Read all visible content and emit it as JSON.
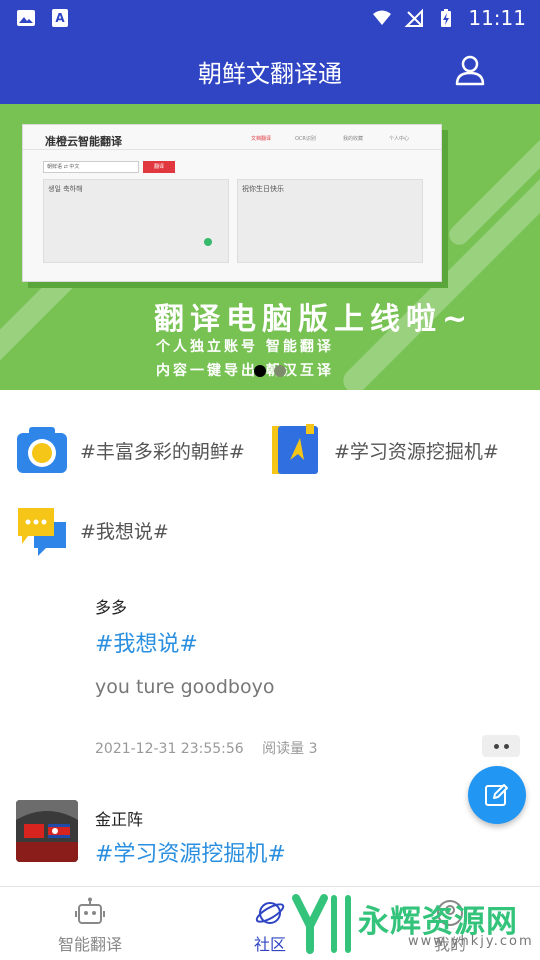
{
  "status_bar": {
    "time": "11:11"
  },
  "header": {
    "title": "朝鲜文翻译通"
  },
  "banner": {
    "screen_title": "准橙云智能翻译",
    "screen_nav": [
      "文档翻译",
      "OCR识别",
      "我的收藏",
      "个人中心"
    ],
    "screen_source_lang": "朝鲜语  ⇄  中文",
    "screen_button": "翻译",
    "screen_input": "생일 축하해",
    "screen_output": "祝你生日快乐",
    "headline": "翻译电脑版上线啦~",
    "line1": "个人独立账号  智能翻译",
    "line2": "内容一键导出  朝汉互译",
    "active_slide": 1,
    "slide_count": 2
  },
  "topics": [
    {
      "label": "#丰富多彩的朝鲜#",
      "icon": "camera-icon"
    },
    {
      "label": "#学习资源挖掘机#",
      "icon": "book-icon"
    },
    {
      "label": "#我想说#",
      "icon": "chat-bubbles-icon"
    }
  ],
  "posts": [
    {
      "author": "多多",
      "tag": "#我想说#",
      "content": "you ture goodboyo",
      "timestamp": "2021-12-31 23:55:56",
      "reads": "阅读量 3"
    },
    {
      "author": "金正阵",
      "tag": "#学习资源挖掘机#"
    }
  ],
  "bottom_nav": [
    {
      "label": "智能翻译",
      "icon": "robot-icon",
      "active": false
    },
    {
      "label": "社区",
      "icon": "planet-icon",
      "active": true
    },
    {
      "label": "我的",
      "icon": "profile-icon",
      "active": false
    }
  ],
  "watermark": {
    "text": "永辉资源网",
    "url": "www.yhkjy.com"
  },
  "colors": {
    "primary": "#2f45c4",
    "accent_blue": "#2196f3",
    "banner_green": "#78c254",
    "tag_blue": "#2a8fe0"
  }
}
